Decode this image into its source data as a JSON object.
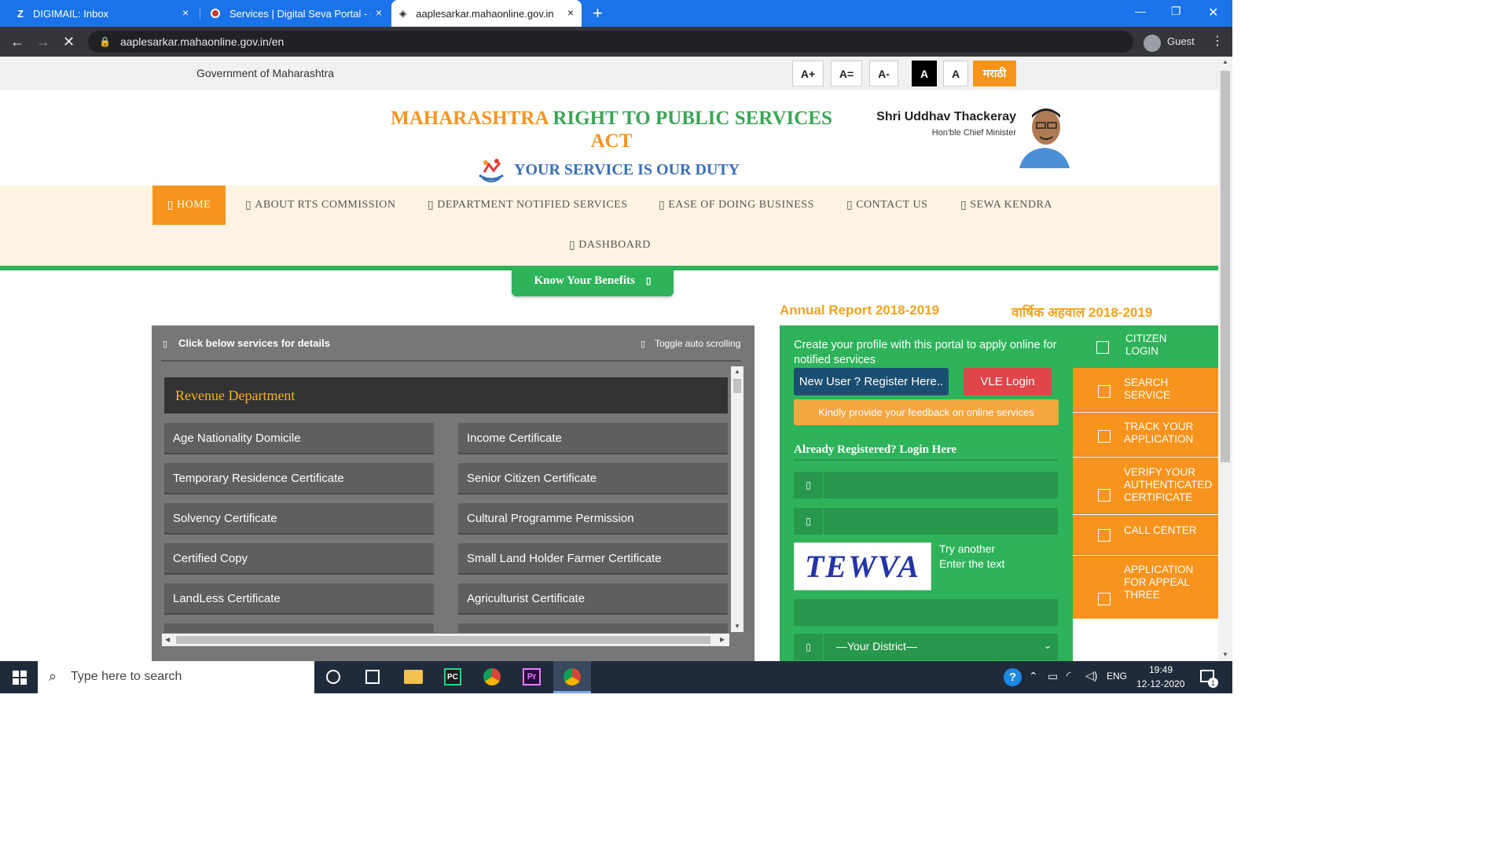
{
  "browser": {
    "tabs": [
      {
        "label": "DIGIMAIL: Inbox",
        "icon": "z-mail-icon"
      },
      {
        "label": "Services | Digital Seva Portal - CSC",
        "icon": "csc-icon"
      },
      {
        "label": "aaplesarkar.mahaonline.gov.in",
        "icon": "page-icon"
      }
    ],
    "url": "aaplesarkar.mahaonline.gov.in/en",
    "profile": "Guest",
    "new_tab": "+",
    "close": "×",
    "win_min": "—",
    "win_max": "❐",
    "win_close": "✕"
  },
  "govbar": {
    "title": "Government of Maharashtra",
    "font_buttons": [
      "A+",
      "A=",
      "A-",
      "A",
      "A"
    ],
    "lang": "मराठी"
  },
  "header": {
    "title_part1": "MAHARASHTRA",
    "title_part2": "RIGHT TO PUBLIC SERVICES",
    "title_part3": "ACT",
    "tagline": "YOUR SERVICE IS OUR DUTY",
    "cm_name": "Shri Uddhav Thackeray",
    "cm_title": "Hon'ble Chief Minister"
  },
  "nav": {
    "items": [
      "HOME",
      "ABOUT RTS COMMISSION",
      "DEPARTMENT NOTIFIED SERVICES",
      "EASE OF DOING BUSINESS",
      "CONTACT US",
      "SEWA KENDRA",
      "DASHBOARD"
    ]
  },
  "benefits": "Know Your Benefits",
  "annual": {
    "en": "Annual Report 2018-2019",
    "mr": "वार्षिक अहवाल 2018-2019"
  },
  "services": {
    "header": "Click below services for details",
    "toggle": "Toggle auto scrolling",
    "department": "Revenue Department",
    "left": [
      "Age Nationality Domicile",
      "Temporary Residence Certificate",
      "Solvency Certificate",
      "Certified Copy",
      "LandLess Certificate"
    ],
    "right": [
      "Income Certificate",
      "Senior Citizen Certificate",
      "Cultural Programme Permission",
      "Small Land Holder Farmer Certificate",
      "Agriculturist Certificate"
    ]
  },
  "login": {
    "intro": "Create your profile with this portal to apply online for notified services",
    "register": "New User ? Register Here..",
    "vle": "VLE Login",
    "feedback": "Kindly provide your feedback on online services",
    "heading": "Already Registered? Login Here",
    "captcha": "TEWVA",
    "try_another": "Try another",
    "enter_text": "Enter the text",
    "district": "—Your District—"
  },
  "right_menu": [
    "CITIZEN LOGIN",
    "SEARCH SERVICE",
    "TRACK YOUR APPLICATION",
    "VERIFY YOUR AUTHENTICATED CERTIFICATE",
    "CALL CENTER",
    "APPLICATION FOR APPEAL THREE"
  ],
  "taskbar": {
    "search": "Type here to search",
    "lang": "ENG",
    "time": "19:49",
    "date": "12-12-2020",
    "notif": "1"
  },
  "colors": {
    "chrome_blue": "#1a73e8",
    "orange": "#f7941d",
    "green": "#2eb35a",
    "rts_green": "#3aa655",
    "tagline_blue": "#3b6fb6"
  }
}
